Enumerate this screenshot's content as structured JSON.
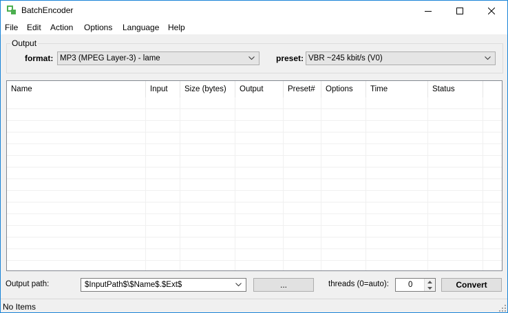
{
  "window": {
    "title": "BatchEncoder"
  },
  "menu": [
    "File",
    "Edit",
    "Action",
    "Options",
    "Language",
    "Help"
  ],
  "output_group": {
    "title": "Output",
    "format_label": "format:",
    "format_value": "MP3 (MPEG Layer-3) - lame",
    "preset_label": "preset:",
    "preset_value": "VBR ~245 kbit/s (V0)"
  },
  "list": {
    "columns": [
      "Name",
      "Input",
      "Size (bytes)",
      "Output",
      "Preset#",
      "Options",
      "Time",
      "Status"
    ],
    "rows": []
  },
  "bottom": {
    "output_path_label": "Output path:",
    "output_path_value": "$InputPath$\\$Name$.$Ext$",
    "browse_label": "...",
    "threads_label": "threads (0=auto):",
    "threads_value": "0",
    "convert_label": "Convert"
  },
  "status": {
    "text": "No Items"
  },
  "colors": {
    "accent_border": "#1883d7",
    "app_icon": "#5cb85c"
  }
}
